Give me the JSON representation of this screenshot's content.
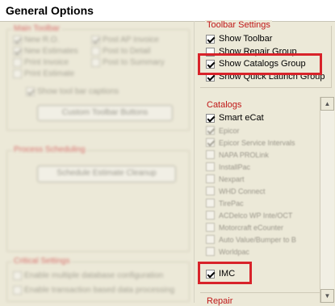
{
  "window": {
    "title": "General Options"
  },
  "left": {
    "main_toolbar": {
      "legend": "Main Toolbar",
      "items": [
        {
          "label": "New R.O.",
          "checked": true
        },
        {
          "label": "New Estimates",
          "checked": true
        },
        {
          "label": "Print Invoice",
          "checked": false
        },
        {
          "label": "Print Estimate",
          "checked": false
        },
        {
          "label": "Post AP Invoice",
          "checked": true
        },
        {
          "label": "Post to Detail",
          "checked": false
        },
        {
          "label": "Post to Summary",
          "checked": false
        },
        {
          "label": "Show tool bar captions",
          "checked": true
        }
      ],
      "button": "Custom Toolbar Buttons"
    },
    "process_scheduling": {
      "legend": "Process Scheduling",
      "button": "Schedule Estimate Cleanup"
    },
    "critical_settings": {
      "legend": "Critical Settings",
      "items": [
        {
          "label": "Enable multiple database configuration",
          "checked": false
        },
        {
          "label": "Enable transaction based data processing",
          "checked": false
        }
      ]
    }
  },
  "toolbar_settings": {
    "legend": "Toolbar Settings",
    "items": [
      {
        "label": "Show Toolbar",
        "checked": true
      },
      {
        "label": "Show Repair Group",
        "checked": false
      },
      {
        "label": "Show Catalogs Group",
        "checked": true
      },
      {
        "label": "Show Quick Launch Group",
        "checked": true
      }
    ]
  },
  "catalogs": {
    "legend": "Catalogs",
    "items": [
      {
        "label": "Smart eCat",
        "checked": true
      },
      {
        "label": "Epicor",
        "checked": true
      },
      {
        "label": "Epicor Service Intervals",
        "checked": true
      },
      {
        "label": "NAPA PROLink",
        "checked": false
      },
      {
        "label": "InstallPac",
        "checked": false
      },
      {
        "label": "Nexpart",
        "checked": false
      },
      {
        "label": "WHD Connect",
        "checked": false
      },
      {
        "label": "TirePac",
        "checked": false
      },
      {
        "label": "ACDelco WP Inte/OCT",
        "checked": false
      },
      {
        "label": "Motorcraft eCounter",
        "checked": false
      },
      {
        "label": "Auto Value/Bumper to B",
        "checked": false
      },
      {
        "label": "Worldpac",
        "checked": false
      },
      {
        "label": "IMC",
        "checked": true
      }
    ]
  },
  "repair": {
    "legend": "Repair"
  },
  "icons": {
    "scroll_up": "▲",
    "scroll_down": "▼"
  },
  "colors": {
    "highlight": "#d8232a",
    "legend_red": "#c01818"
  }
}
